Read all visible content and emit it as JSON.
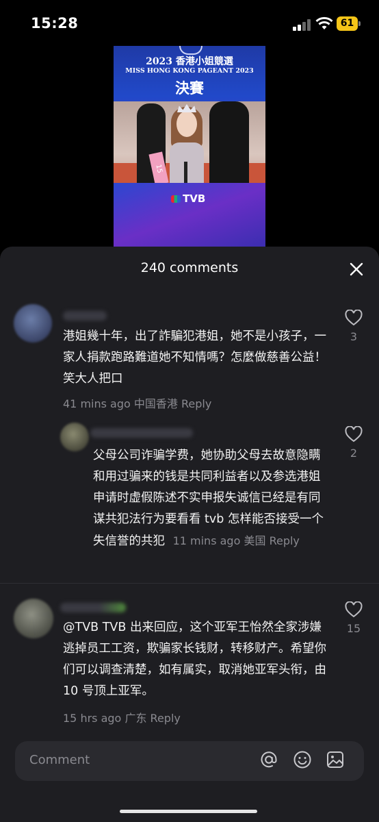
{
  "status_bar": {
    "time": "15:28",
    "battery": "61"
  },
  "video": {
    "title_line1": "2023 香港小姐競選",
    "title_line2": "MISS HONG KONG PAGEANT 2023",
    "title_line3": "決賽",
    "channel": "TVB",
    "sash_number": "15"
  },
  "comments_sheet": {
    "title": "240 comments",
    "comments": [
      {
        "text": "港姐幾十年，出了詐騙犯港姐，她不是小孩子，一家人捐款跑路難道她不知情嗎？怎麼做慈善公益！笑大人把口",
        "time": "41 mins ago",
        "location": "中国香港",
        "reply_label": "Reply",
        "likes": "3"
      },
      {
        "text": "父母公司诈骗学费，她协助父母去故意隐瞒和用过骗来的钱是共同利益者以及参选港姐申请时虚假陈述不实申报失诚信已经是有同谋共犯法行为要看看 tvb 怎样能否接受一个失信誉的共犯",
        "time": "11 mins ago",
        "location": "美国",
        "reply_label": "Reply",
        "likes": "2"
      },
      {
        "text": "@TVB TVB 出来回应，这个亚军王怡然全家涉嫌逃掉员工工资，欺骗家长钱财，转移财产。希望你们可以调查清楚，如有属实，取消她亚军头衔，由 10 号顶上亚军。",
        "time": "15 hrs ago",
        "location": "广东",
        "reply_label": "Reply",
        "likes": "15"
      }
    ],
    "input_placeholder": "Comment"
  },
  "icons": {
    "close": "close-icon",
    "like": "heart-outline-icon",
    "mention": "at-sign-icon",
    "emoji": "smiley-icon",
    "image": "image-icon"
  }
}
